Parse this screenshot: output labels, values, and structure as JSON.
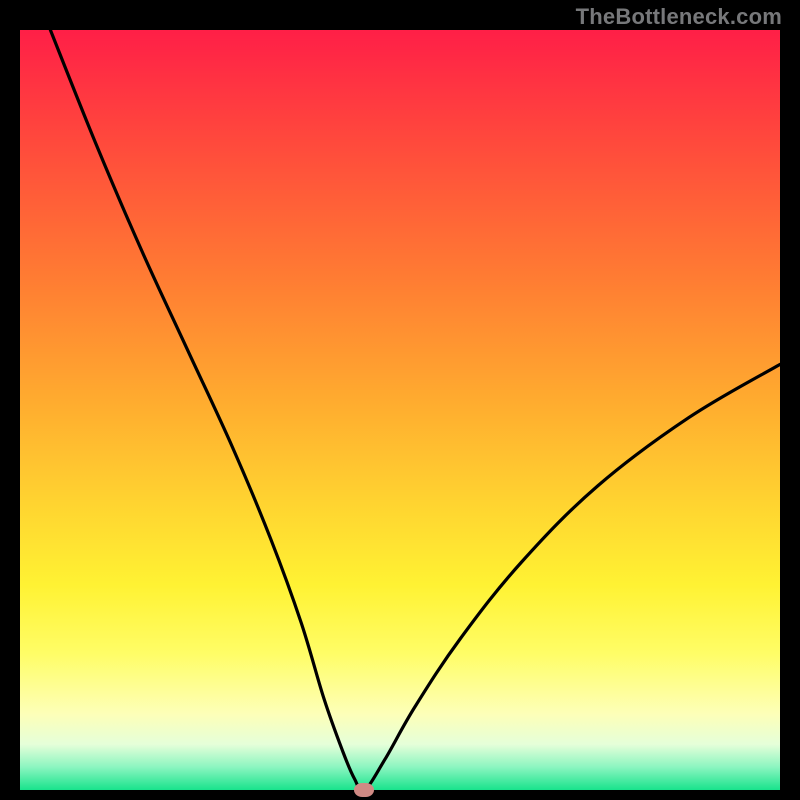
{
  "watermark": "TheBottleneck.com",
  "chart_data": {
    "type": "line",
    "title": "",
    "xlabel": "",
    "ylabel": "",
    "xlim": [
      0,
      100
    ],
    "ylim": [
      0,
      100
    ],
    "grid": false,
    "legend": null,
    "background_gradient": {
      "direction": "vertical",
      "stops": [
        {
          "pos": 0,
          "color": "#ff1f47"
        },
        {
          "pos": 32,
          "color": "#ff7a33"
        },
        {
          "pos": 62,
          "color": "#ffd330"
        },
        {
          "pos": 82,
          "color": "#fffd66"
        },
        {
          "pos": 97,
          "color": "#8bf5c0"
        },
        {
          "pos": 100,
          "color": "#19e38c"
        }
      ]
    },
    "series": [
      {
        "name": "bottleneck-curve",
        "x": [
          4,
          10,
          16,
          22,
          28,
          33,
          37,
          40,
          42.5,
          44,
          45.3,
          48,
          52,
          58,
          66,
          76,
          88,
          100
        ],
        "y": [
          100,
          85,
          71,
          58,
          45,
          33,
          22,
          12,
          5,
          1.5,
          0,
          4,
          11,
          20,
          30,
          40,
          49,
          56
        ]
      }
    ],
    "marker": {
      "x": 45.3,
      "y": 0,
      "color": "#d08a84"
    }
  }
}
